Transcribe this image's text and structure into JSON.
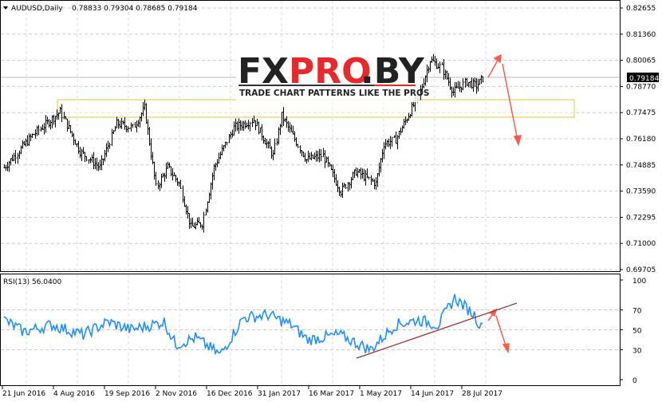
{
  "header": {
    "symbol": "AUDUSD,Daily",
    "ohlc": "0.78833 0.79304 0.78685 0.79184"
  },
  "logo": {
    "title_dark1": "FX",
    "title_red": "PRO",
    "title_dark2": ".BY",
    "tagline": "TRADE CHART PATTERNS LIKE THE PROS"
  },
  "rsi_label": "RSI(13) 56.0400",
  "colors": {
    "bars": "#000000",
    "rsi": "#1e90ff",
    "arrow": "#ff5a4a",
    "trendline": "#a52a2a",
    "zone": "#f5c242",
    "grid": "#c8c8c8"
  },
  "chart_data": [
    {
      "type": "bar",
      "title": "AUDUSD Daily",
      "current_price": "0.79184",
      "ylim": [
        0.69705,
        0.82655
      ],
      "yticks": [
        "0.82655",
        "0.81360",
        "0.80065",
        "0.78770",
        "0.77475",
        "0.76180",
        "0.74885",
        "0.73590",
        "0.72295",
        "0.71000",
        "0.69705"
      ],
      "xticks": [
        "21 Jun 2016",
        "4 Aug 2016",
        "19 Sep 2016",
        "2 Nov 2016",
        "16 Dec 2016",
        "31 Jan 2017",
        "16 Mar 2017",
        "1 May 2017",
        "14 Jun 2017",
        "28 Jul 2017"
      ],
      "path_bar_index": [
        0,
        17,
        34,
        46,
        58,
        68,
        78,
        85,
        92,
        99,
        106,
        113,
        120,
        127,
        139,
        151,
        163,
        168,
        183,
        193,
        204,
        213,
        225,
        230,
        237,
        251,
        258,
        265,
        272,
        280,
        286,
        290
      ],
      "path_close": [
        0.7476,
        0.7634,
        0.7752,
        0.7555,
        0.7476,
        0.7693,
        0.7673,
        0.777,
        0.7377,
        0.7476,
        0.7397,
        0.718,
        0.72,
        0.7476,
        0.7673,
        0.7712,
        0.7535,
        0.7732,
        0.7515,
        0.7535,
        0.7357,
        0.7456,
        0.7397,
        0.7594,
        0.7614,
        0.783,
        0.8009,
        0.797,
        0.785,
        0.79,
        0.788,
        0.7918
      ],
      "resistance_zone": [
        0.776,
        0.779
      ]
    },
    {
      "type": "line",
      "title": "RSI(13)",
      "value": 56.04,
      "ylim": [
        0,
        100
      ],
      "yticks": [
        "100",
        "70",
        "50",
        "30",
        "0"
      ],
      "path_bar_index": [
        0,
        12,
        29,
        48,
        63,
        77,
        97,
        104,
        116,
        131,
        145,
        160,
        174,
        184,
        203,
        222,
        237,
        251,
        263,
        273,
        285,
        291,
        294
      ],
      "path_rsi": [
        60,
        48,
        55,
        45,
        58,
        50,
        58,
        35,
        42,
        25,
        62,
        65,
        55,
        40,
        45,
        30,
        55,
        60,
        55,
        82,
        65,
        45,
        56
      ],
      "trendline_rsi": [
        [
          220,
          22
        ],
        [
          311,
          72
        ]
      ]
    }
  ]
}
